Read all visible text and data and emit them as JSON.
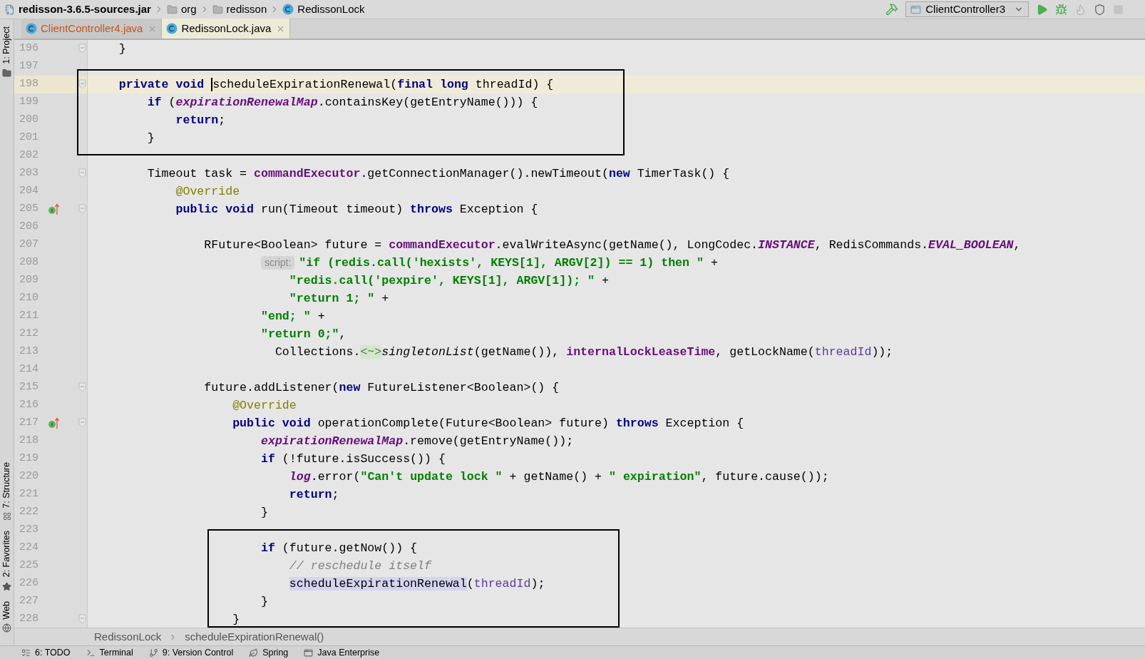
{
  "path_bar": {
    "items": [
      {
        "kind": "jar",
        "label": "redisson-3.6.5-sources.jar"
      },
      {
        "kind": "folder",
        "label": "org"
      },
      {
        "kind": "folder",
        "label": "redisson"
      },
      {
        "kind": "class",
        "label": "RedissonLock"
      }
    ],
    "run_config": "ClientController3"
  },
  "tool_windows_left": [
    {
      "kind": "project",
      "label": "1: Project"
    },
    {
      "kind": "structure",
      "label": "7: Structure"
    },
    {
      "kind": "favorites",
      "label": "2: Favorites"
    },
    {
      "kind": "web",
      "label": "Web"
    }
  ],
  "tabs": [
    {
      "label": "ClientController4.java",
      "selected": false,
      "modified": true
    },
    {
      "label": "RedissonLock.java",
      "selected": true,
      "modified": false
    }
  ],
  "editor": {
    "lines": [
      {
        "number": "196",
        "current": false,
        "override": false,
        "fold": true,
        "code": [
          {
            "kind": "plain",
            "text": "    }"
          }
        ]
      },
      {
        "number": "197",
        "current": false,
        "override": false,
        "fold": false
      },
      {
        "number": "198",
        "current": true,
        "override": false,
        "fold": true,
        "code": [
          {
            "kind": "kw",
            "text": "    private void "
          },
          {
            "kind": "plain",
            "text": "scheduleExpirationRenewal",
            "caret": true
          },
          {
            "kind": "plain",
            "text": "("
          },
          {
            "kind": "kw",
            "text": "final long"
          },
          {
            "kind": "plain",
            "text": " threadId) {"
          }
        ]
      },
      {
        "number": "199",
        "current": false,
        "override": false,
        "fold": false,
        "code": [
          {
            "kind": "kw",
            "text": "        if"
          },
          {
            "kind": "plain",
            "text": " ("
          },
          {
            "kind": "sfield",
            "text": "expirationRenewalMap"
          },
          {
            "kind": "plain",
            "text": ".containsKey(getEntryName())) {"
          }
        ]
      },
      {
        "number": "200",
        "current": false,
        "override": false,
        "fold": false,
        "code": [
          {
            "kind": "kw",
            "text": "            return"
          },
          {
            "kind": "plain",
            "text": ";"
          }
        ]
      },
      {
        "number": "201",
        "current": false,
        "override": false,
        "fold": false,
        "code": [
          {
            "kind": "plain",
            "text": "        }"
          }
        ]
      },
      {
        "number": "202",
        "current": false,
        "override": false,
        "fold": false
      },
      {
        "number": "203",
        "current": false,
        "override": false,
        "fold": true,
        "code": [
          {
            "kind": "plain",
            "text": "        Timeout task = "
          },
          {
            "kind": "field",
            "text": "commandExecutor"
          },
          {
            "kind": "plain",
            "text": ".getConnectionManager().newTimeout("
          },
          {
            "kind": "kw",
            "text": "new"
          },
          {
            "kind": "plain",
            "text": " TimerTask() {"
          }
        ]
      },
      {
        "number": "204",
        "current": false,
        "override": false,
        "fold": false,
        "code": [
          {
            "kind": "ann",
            "text": "            @Override"
          }
        ]
      },
      {
        "number": "205",
        "current": false,
        "override": true,
        "fold": true,
        "code": [
          {
            "kind": "kw",
            "text": "            public void"
          },
          {
            "kind": "plain",
            "text": " run(Timeout timeout) "
          },
          {
            "kind": "kw",
            "text": "throws"
          },
          {
            "kind": "plain",
            "text": " Exception {"
          }
        ]
      },
      {
        "number": "206",
        "current": false,
        "override": false,
        "fold": false
      },
      {
        "number": "207",
        "current": false,
        "override": false,
        "fold": false,
        "code": [
          {
            "kind": "plain",
            "text": "                RFuture<Boolean> future = "
          },
          {
            "kind": "field",
            "text": "commandExecutor"
          },
          {
            "kind": "plain",
            "text": ".evalWriteAsync(getName(), LongCodec."
          },
          {
            "kind": "sfield",
            "text": "INSTANCE"
          },
          {
            "kind": "plain",
            "text": ", RedisCommands."
          },
          {
            "kind": "sfield",
            "text": "EVAL_BOOLEAN"
          },
          {
            "kind": "plain",
            "text": ","
          }
        ]
      },
      {
        "number": "208",
        "current": false,
        "override": false,
        "fold": false,
        "code": [
          {
            "kind": "hint",
            "text": "                        script:"
          },
          {
            "kind": "str",
            "text": "\"if (redis.call('hexists', KEYS[1], ARGV[2]) == 1) then \""
          },
          {
            "kind": "plain",
            "text": " +"
          }
        ]
      },
      {
        "number": "209",
        "current": false,
        "override": false,
        "fold": false,
        "code": [
          {
            "kind": "str",
            "text": "                            \"redis.call('pexpire', KEYS[1], ARGV[1]); \""
          },
          {
            "kind": "plain",
            "text": " +"
          }
        ]
      },
      {
        "number": "210",
        "current": false,
        "override": false,
        "fold": false,
        "code": [
          {
            "kind": "str",
            "text": "                            \"return 1; \""
          },
          {
            "kind": "plain",
            "text": " +"
          }
        ]
      },
      {
        "number": "211",
        "current": false,
        "override": false,
        "fold": false,
        "code": [
          {
            "kind": "str",
            "text": "                        \"end; \""
          },
          {
            "kind": "plain",
            "text": " +"
          }
        ]
      },
      {
        "number": "212",
        "current": false,
        "override": false,
        "fold": false,
        "code": [
          {
            "kind": "str",
            "text": "                        \"return 0;\""
          },
          {
            "kind": "plain",
            "text": ","
          }
        ]
      },
      {
        "number": "213",
        "current": false,
        "override": false,
        "fold": false,
        "code": [
          {
            "kind": "plain",
            "text": "                          Collections."
          },
          {
            "kind": "diamond",
            "text": "<~>"
          },
          {
            "kind": "scall",
            "text": "singletonList"
          },
          {
            "kind": "plain",
            "text": "(getName()), "
          },
          {
            "kind": "field",
            "text": "internalLockLeaseTime"
          },
          {
            "kind": "plain",
            "text": ", getLockName("
          },
          {
            "kind": "param",
            "text": "threadId"
          },
          {
            "kind": "plain",
            "text": "));"
          }
        ]
      },
      {
        "number": "214",
        "current": false,
        "override": false,
        "fold": false
      },
      {
        "number": "215",
        "current": false,
        "override": false,
        "fold": true,
        "code": [
          {
            "kind": "plain",
            "text": "                future.addListener("
          },
          {
            "kind": "kw",
            "text": "new"
          },
          {
            "kind": "plain",
            "text": " FutureListener<Boolean>() {"
          }
        ]
      },
      {
        "number": "216",
        "current": false,
        "override": false,
        "fold": false,
        "code": [
          {
            "kind": "ann",
            "text": "                    @Override"
          }
        ]
      },
      {
        "number": "217",
        "current": false,
        "override": true,
        "fold": true,
        "code": [
          {
            "kind": "kw",
            "text": "                    public void"
          },
          {
            "kind": "plain",
            "text": " operationComplete(Future<Boolean> future) "
          },
          {
            "kind": "kw",
            "text": "throws"
          },
          {
            "kind": "plain",
            "text": " Exception {"
          }
        ]
      },
      {
        "number": "218",
        "current": false,
        "override": false,
        "fold": false,
        "code": [
          {
            "kind": "sfield",
            "text": "                        expirationRenewalMap"
          },
          {
            "kind": "plain",
            "text": ".remove(getEntryName());"
          }
        ]
      },
      {
        "number": "219",
        "current": false,
        "override": false,
        "fold": false,
        "code": [
          {
            "kind": "kw",
            "text": "                        if"
          },
          {
            "kind": "plain",
            "text": " (!future.isSuccess()) {"
          }
        ]
      },
      {
        "number": "220",
        "current": false,
        "override": false,
        "fold": false,
        "code": [
          {
            "kind": "sfield",
            "text": "                            log"
          },
          {
            "kind": "plain",
            "text": ".error("
          },
          {
            "kind": "str",
            "text": "\"Can't update lock \""
          },
          {
            "kind": "plain",
            "text": " + getName() + "
          },
          {
            "kind": "str",
            "text": "\" expiration\""
          },
          {
            "kind": "plain",
            "text": ", future.cause());"
          }
        ]
      },
      {
        "number": "221",
        "current": false,
        "override": false,
        "fold": false,
        "code": [
          {
            "kind": "kw",
            "text": "                            return"
          },
          {
            "kind": "plain",
            "text": ";"
          }
        ]
      },
      {
        "number": "222",
        "current": false,
        "override": false,
        "fold": false,
        "code": [
          {
            "kind": "plain",
            "text": "                        }"
          }
        ]
      },
      {
        "number": "223",
        "current": false,
        "override": false,
        "fold": false
      },
      {
        "number": "224",
        "current": false,
        "override": false,
        "fold": false,
        "code": [
          {
            "kind": "kw",
            "text": "                        if"
          },
          {
            "kind": "plain",
            "text": " (future.getNow()) {"
          }
        ]
      },
      {
        "number": "225",
        "current": false,
        "override": false,
        "fold": false,
        "code": [
          {
            "kind": "comment",
            "text": "                            // reschedule itself"
          }
        ]
      },
      {
        "number": "226",
        "current": false,
        "override": false,
        "fold": false,
        "code": [
          {
            "kind": "usage",
            "text": "                            scheduleExpirationRenewal"
          },
          {
            "kind": "plain",
            "text": "("
          },
          {
            "kind": "param",
            "text": "threadId"
          },
          {
            "kind": "plain",
            "text": ");"
          }
        ]
      },
      {
        "number": "227",
        "current": false,
        "override": false,
        "fold": false,
        "code": [
          {
            "kind": "plain",
            "text": "                        }"
          }
        ]
      },
      {
        "number": "228",
        "current": false,
        "override": false,
        "fold": true,
        "code": [
          {
            "kind": "plain",
            "text": "                    }"
          }
        ]
      }
    ]
  },
  "breadcrumbs": [
    "RedissonLock",
    "scheduleExpirationRenewal()"
  ],
  "bottom_tools": [
    {
      "kind": "todo",
      "label": "6: TODO"
    },
    {
      "kind": "terminal",
      "label": "Terminal"
    },
    {
      "kind": "vcs",
      "label": "9: Version Control"
    },
    {
      "kind": "spring",
      "label": "Spring"
    },
    {
      "kind": "enterprise",
      "label": "Java Enterprise"
    }
  ]
}
